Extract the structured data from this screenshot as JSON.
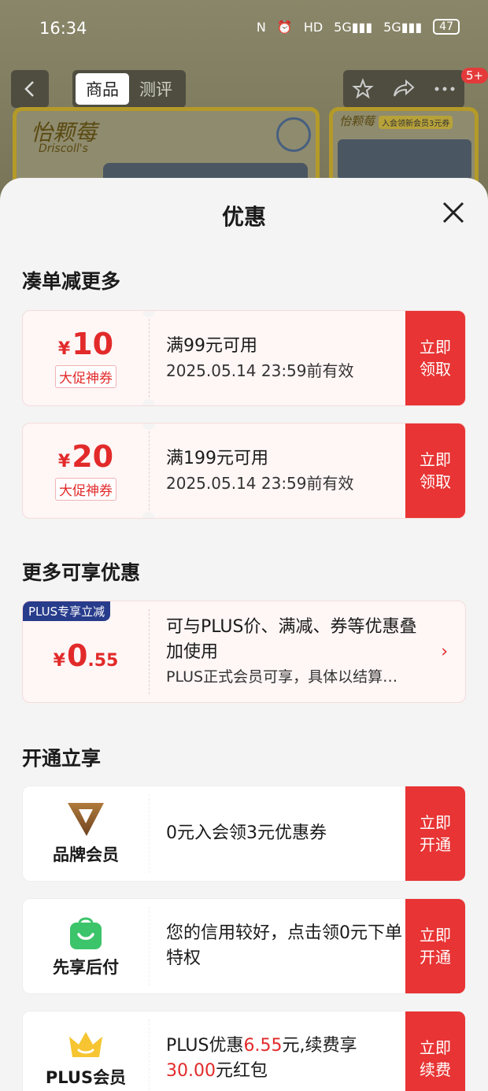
{
  "status_bar": {
    "time": "16:34",
    "battery": "47"
  },
  "product_page": {
    "tabs": [
      "商品",
      "测评"
    ],
    "badge": "5+",
    "brand": "怡颗莓",
    "brand_sub": "Driscoll's",
    "card2_tag": "入会领新会员3元券"
  },
  "sheet": {
    "title": "优惠",
    "sections": {
      "s1": "凑单减更多",
      "s2": "更多可享优惠",
      "s3": "开通立享"
    },
    "coupons": [
      {
        "currency": "¥",
        "amount": "10",
        "tag": "大促神券",
        "condition": "满99元可用",
        "valid": "2025.05.14 23:59前有效",
        "action": "立即\n领取"
      },
      {
        "currency": "¥",
        "amount": "20",
        "tag": "大促神券",
        "condition": "满199元可用",
        "valid": "2025.05.14 23:59前有效",
        "action": "立即\n领取"
      }
    ],
    "plus_offer": {
      "ribbon": "PLUS专享立减",
      "currency": "¥",
      "amount_int": "0",
      "amount_dec": ".55",
      "desc": "可与PLUS价、满减、券等优惠叠加使用",
      "note": "PLUS正式会员可享，具体以结算…"
    },
    "memberships": [
      {
        "name": "品牌会员",
        "desc": "0元入会领3元优惠券",
        "action": "立即\n开通",
        "icon": "brand-v-icon"
      },
      {
        "name": "先享后付",
        "desc": "您的信用较好，点击领0元下单特权",
        "action": "立即\n开通",
        "icon": "shopping-bag-icon"
      },
      {
        "name": "PLUS会员",
        "desc_a": "PLUS优惠",
        "desc_b": "6.55",
        "desc_c": "元,续费享",
        "desc_d": "30.00",
        "desc_e": "元红包",
        "action": "立即\n续费",
        "icon": "crown-icon"
      }
    ]
  },
  "colors": {
    "accent_red": "#e83434",
    "plus_blue": "#283c8c",
    "bag_green": "#3cc46a",
    "crown_yellow": "#f6c531"
  }
}
